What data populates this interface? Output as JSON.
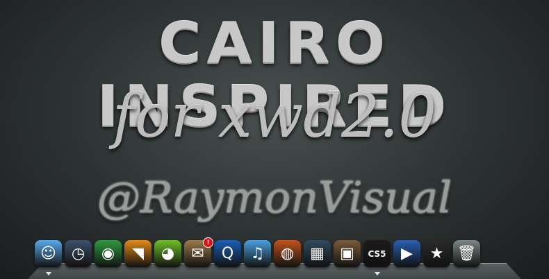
{
  "banner": {
    "title": "CAIRO INSPIRED",
    "subtitle": "for xwd2.0",
    "author": "@RaymonVisual"
  },
  "dock": {
    "items": [
      {
        "name": "finder-icon",
        "glyph": "☺",
        "bg": "#5aa9ea",
        "active": true
      },
      {
        "name": "time-machine-icon",
        "glyph": "◷",
        "bg": "#3d4f6a",
        "active": false
      },
      {
        "name": "chrome-icon",
        "glyph": "◉",
        "bg": "#2f9a3f",
        "active": false
      },
      {
        "name": "rss-icon",
        "glyph": "◥",
        "bg": "#e38a19",
        "active": false
      },
      {
        "name": "adium-icon",
        "glyph": "◕",
        "bg": "#6fbf2a",
        "active": false
      },
      {
        "name": "mail-icon",
        "glyph": "✉",
        "bg": "#9a7a4a",
        "active": false,
        "badge": "!"
      },
      {
        "name": "quicktime-icon",
        "glyph": "Q",
        "bg": "#1c5fb8",
        "active": false
      },
      {
        "name": "itunes-icon",
        "glyph": "♫",
        "bg": "#4aa0e0",
        "active": false
      },
      {
        "name": "firefox-icon",
        "glyph": "◍",
        "bg": "#c0541c",
        "active": false
      },
      {
        "name": "dashboard-icon",
        "glyph": "▦",
        "bg": "#33495e",
        "active": false
      },
      {
        "name": "photos-icon",
        "glyph": "▣",
        "bg": "#7a5a3a",
        "active": false
      },
      {
        "name": "photoshop-cs5-icon",
        "glyph": "CS5",
        "bg": "#1b1b1b",
        "active": true
      },
      {
        "name": "imovie-icon",
        "glyph": "▶",
        "bg": "#2a5fb0",
        "active": false
      },
      {
        "name": "imovie-star-icon",
        "glyph": "★",
        "bg": "#2a2a2a",
        "active": false
      },
      {
        "name": "trash-icon",
        "glyph": "🗑",
        "bg": "#7c8585",
        "active": false
      }
    ]
  }
}
